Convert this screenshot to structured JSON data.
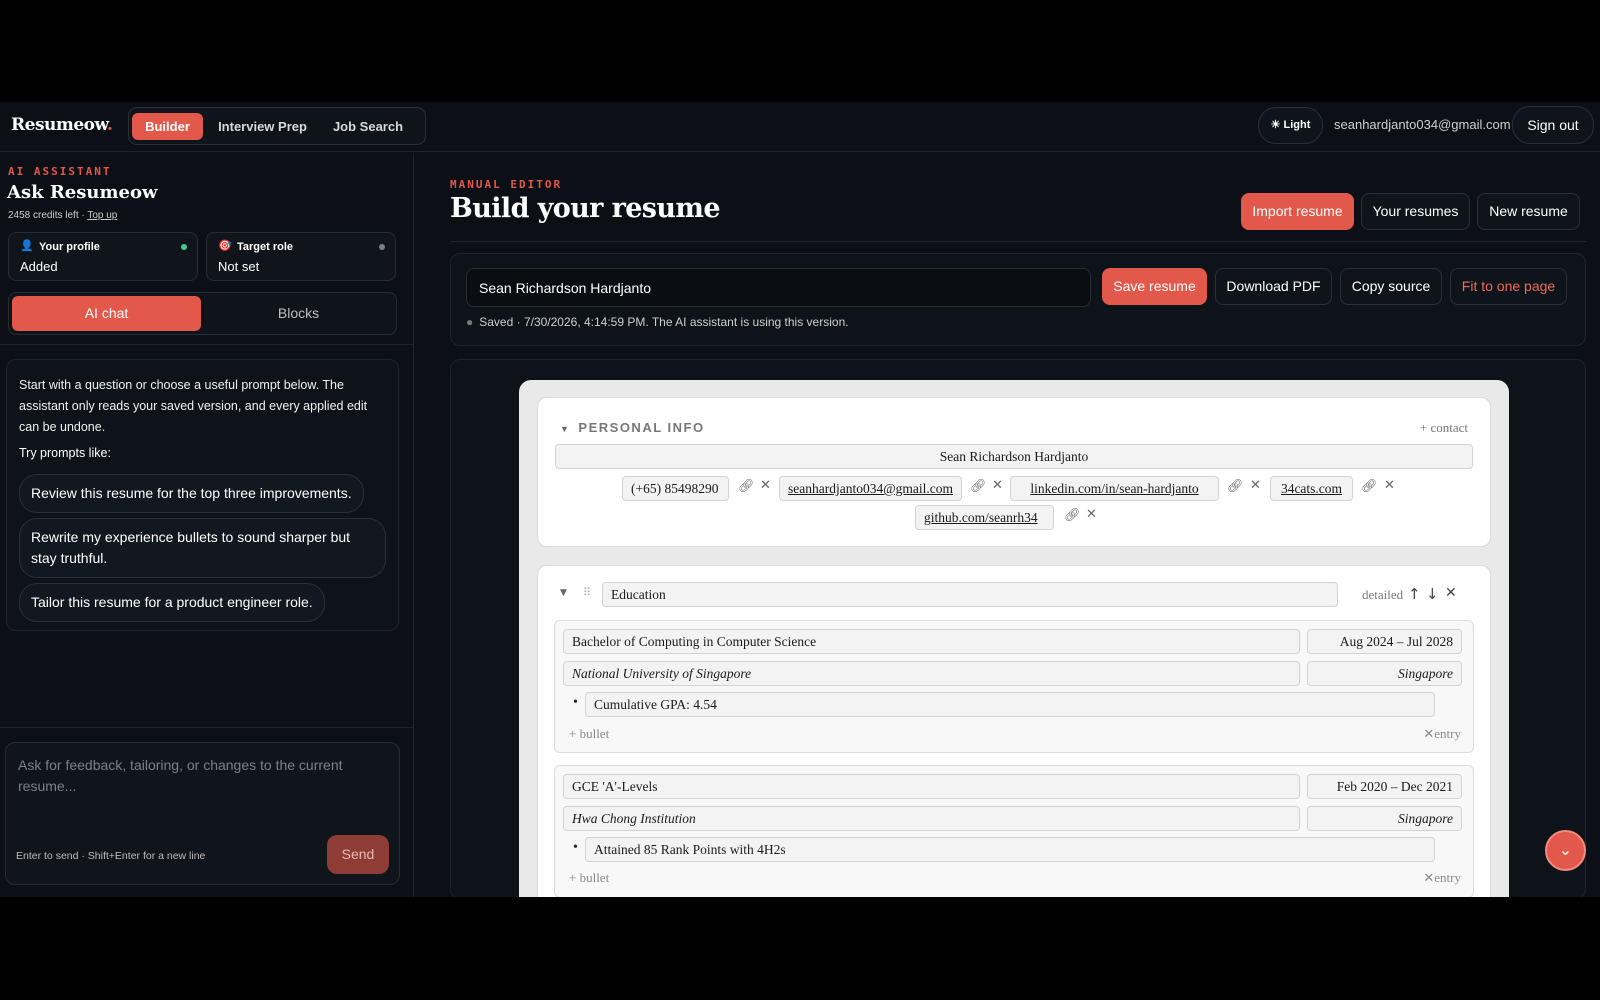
{
  "topbar": {
    "logo": "Resumeow",
    "logo_dot": ".",
    "tabs": [
      {
        "label": "Builder"
      },
      {
        "label": "Interview Prep"
      },
      {
        "label": "Job Search"
      }
    ],
    "theme_label": "Light",
    "user_email": "seanhardjanto034@gmail.com",
    "signout_label": "Sign out"
  },
  "sidebar": {
    "kicker": "AI ASSISTANT",
    "title": "Ask Resumeow",
    "credits": "2458 credits left · ",
    "topup": "Top up",
    "profile_card": {
      "label": "Your profile",
      "value": "Added",
      "status_color": "#3ecf8e"
    },
    "role_card": {
      "label": "Target role",
      "value": "Not set",
      "status_color": "#7a7f86"
    },
    "tabs": [
      {
        "label": "AI chat"
      },
      {
        "label": "Blocks"
      }
    ],
    "intro": "Start with a question or choose a useful prompt below. The assistant only reads your saved version, and every applied edit can be undone.",
    "try_label": "Try prompts like:",
    "prompts": [
      "Review this resume for the top three improvements.",
      "Rewrite my experience bullets to sound sharper but stay truthful.",
      "Tailor this resume for a product engineer role."
    ],
    "composer_placeholder": "Ask for feedback, tailoring, or changes to the current resume...",
    "composer_hint": "Enter to send · Shift+Enter for a new line",
    "send_label": "Send"
  },
  "main": {
    "kicker": "MANUAL EDITOR",
    "title": "Build your resume",
    "header_buttons": {
      "import": "Import resume",
      "yours": "Your resumes",
      "new": "New resume"
    },
    "resume_name": "Sean Richardson Hardjanto",
    "actions": {
      "save": "Save resume",
      "download": "Download PDF",
      "copy": "Copy source",
      "fit": "Fit to one page"
    },
    "saved_status": "Saved · 7/30/2026, 4:14:59 PM. The AI assistant is using this version."
  },
  "resume": {
    "personal": {
      "heading": "PERSONAL INFO",
      "add_contact": "+ contact",
      "name": "Sean Richardson Hardjanto",
      "phone": "(+65) 85498290",
      "email": "seanhardjanto034@gmail.com",
      "linkedin": "linkedin.com/in/sean-hardjanto",
      "website": "34cats.com",
      "github": "github.com/seanrh34"
    },
    "education": {
      "title": "Education",
      "mode": "detailed",
      "add_bullet": "+ bullet",
      "remove_entry": "entry",
      "entries": [
        {
          "degree": "Bachelor of Computing in Computer Science",
          "dates": "Aug 2024 – Jul 2028",
          "school": "National University of Singapore",
          "location": "Singapore",
          "bullets": [
            "Cumulative GPA: 4.54"
          ]
        },
        {
          "degree": "GCE 'A'-Levels",
          "dates": "Feb 2020 – Dec 2021",
          "school": "Hwa Chong Institution",
          "location": "Singapore",
          "bullets": [
            "Attained 85 Rank Points with 4H2s"
          ]
        }
      ]
    }
  },
  "colors": {
    "accent": "#e2584a",
    "background": "#0c1016"
  }
}
